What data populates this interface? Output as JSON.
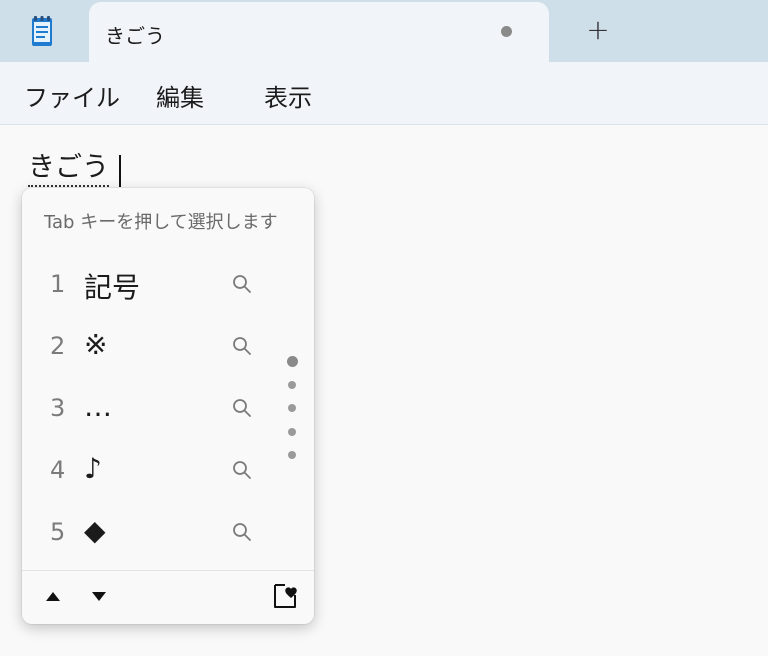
{
  "tabbar": {
    "app_icon": "notepad-icon",
    "tab_title": "きごう",
    "unsaved_indicator": "unsaved-dot-icon",
    "new_tab_label": "+"
  },
  "menu": {
    "items": [
      "ファイル",
      "編集",
      "表示"
    ]
  },
  "editor": {
    "composition_text": "きごう"
  },
  "ime": {
    "hint": "Tab キーを押して選択します",
    "candidates": [
      {
        "number": "1",
        "text": "記号"
      },
      {
        "number": "2",
        "text": "※"
      },
      {
        "number": "3",
        "text": "…"
      },
      {
        "number": "4",
        "text": "♪"
      },
      {
        "number": "5",
        "text": "◆"
      }
    ],
    "page_indicator": {
      "pages": 5,
      "current": 1
    },
    "footer": {
      "prev_icon": "triangle-up-icon",
      "next_icon": "triangle-down-icon",
      "favorite_icon": "heart-bookmark-icon"
    }
  },
  "colors": {
    "tabbar_bg": "#cfdfea",
    "menubar_bg": "#f1f4f8",
    "editor_bg": "#f9f9f9"
  }
}
